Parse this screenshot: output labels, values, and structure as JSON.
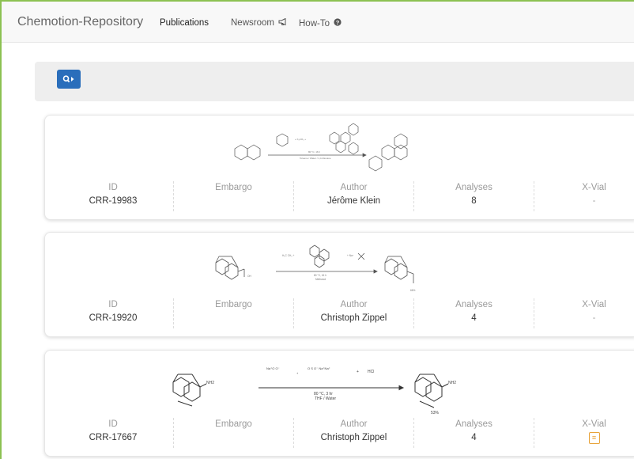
{
  "navbar": {
    "brand": "Chemotion-Repository",
    "links": [
      {
        "label": "Publications"
      },
      {
        "label": "Newsroom",
        "icon": "bullhorn-icon"
      },
      {
        "label": "How-To",
        "icon": "question-circle-icon"
      }
    ]
  },
  "search": {
    "button_icon": "search-icon"
  },
  "columns": {
    "id": "ID",
    "embargo": "Embargo",
    "author": "Author",
    "analyses": "Analyses",
    "xvial": "X-Vial"
  },
  "entries": [
    {
      "id": "CRR-19983",
      "embargo": "",
      "author": "Jérôme Klein",
      "analyses": "8",
      "xvial": "-"
    },
    {
      "id": "CRR-19920",
      "embargo": "",
      "author": "Christoph Zippel",
      "analyses": "4",
      "xvial": "-"
    },
    {
      "id": "CRR-17667",
      "embargo": "",
      "author": "Christoph Zippel",
      "analyses": "4",
      "xvial_icon": "vial-icon",
      "scheme": {
        "conditions_1": "80 °C, 3 hr",
        "conditions_2": "THF / Water",
        "yield": "53%",
        "reactant_labels": [
          "NH2",
          "HCl"
        ]
      }
    }
  ],
  "colors": {
    "accent": "#2a6ebb",
    "vial": "#e8a33a",
    "frame": "#8cc152"
  }
}
